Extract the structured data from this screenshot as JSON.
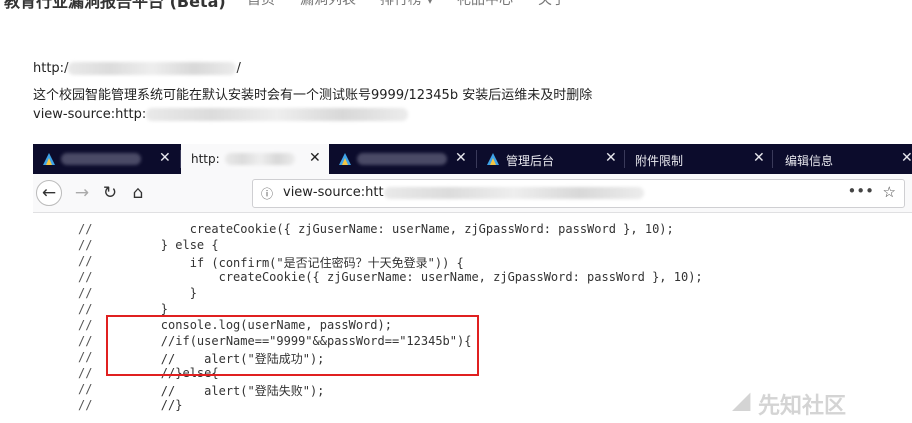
{
  "site": {
    "brand": "教育行业漏洞报告平台 (Beta)",
    "nav": [
      "首页",
      "漏洞列表",
      "排行榜 ▾",
      "礼品中心",
      "关于"
    ]
  },
  "report": {
    "line1_prefix": "http:/",
    "line1_suffix": "/",
    "line2": "这个校园智能管理系统可能在默认安装时会有一个测试账号9999/12345b 安装后运维未及时删除",
    "line3_prefix": "view-source:http:"
  },
  "browser": {
    "tabs": [
      {
        "label": "",
        "close": "✕",
        "active": false
      },
      {
        "label": "http:",
        "close": "✕",
        "active": true
      },
      {
        "label": "",
        "close": "✕",
        "active": false
      },
      {
        "label": "管理后台",
        "close": "✕",
        "active": false
      },
      {
        "label": "附件限制",
        "close": "✕",
        "active": false
      },
      {
        "label": "编辑信息",
        "close": "✕",
        "active": false
      }
    ],
    "back_icon": "←",
    "forward_icon": "→",
    "reload_icon": "↻",
    "home_icon": "⌂",
    "info_icon": "ⓘ",
    "url": "view-source:htt",
    "menu_dots": "•••",
    "bookmark_star": "☆"
  },
  "code": {
    "gutter": [
      "//",
      "//",
      "//",
      "//",
      "//",
      "//",
      "//",
      "//",
      "//",
      "//",
      "//",
      "//"
    ],
    "lines": [
      "            createCookie({ zjGuserName: userName, zjGpassWord: passWord }, 10);",
      "        } else {",
      "            if (confirm(\"是否记住密码？十天免登录\")) {",
      "                createCookie({ zjGuserName: userName, zjGpassWord: passWord }, 10);",
      "            }",
      "        }",
      "        console.log(userName, passWord);",
      "        //if(userName==\"9999\"&&passWord==\"12345b\"){",
      "        //    alert(\"登陆成功\");",
      "        //}else{",
      "        //    alert(\"登陆失败\");",
      "        //}"
    ]
  },
  "watermark": "先知社区"
}
